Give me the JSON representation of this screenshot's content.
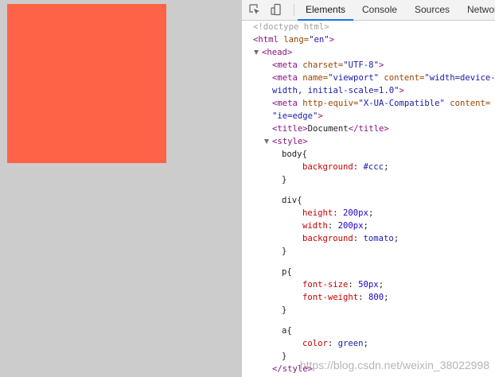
{
  "devtools": {
    "tabs": [
      {
        "label": "Elements",
        "active": true
      },
      {
        "label": "Console",
        "active": false
      },
      {
        "label": "Sources",
        "active": false
      },
      {
        "label": "Network",
        "active": false
      }
    ],
    "icons": {
      "inspect": "select-element-icon",
      "device": "device-toolbar-icon"
    }
  },
  "page_preview": {
    "box_color": "#ff6347",
    "background_color": "#cccccc"
  },
  "source": {
    "doctype": "<!doctype html>",
    "html_open": "<html",
    "html_attr": " lang=",
    "html_attr_val": "\"en\"",
    "html_close": ">",
    "head_tag": "<head>",
    "meta1_tag": "<meta",
    "meta1_attr": " charset=",
    "meta1_val": "\"UTF-8\"",
    "meta1_end": ">",
    "meta2_tag": "<meta",
    "meta2_attr1": " name=",
    "meta2_val1": "\"viewport\"",
    "meta2_attr2": " content=",
    "meta2_val2a": "\"width=device-",
    "meta2_val2b": "width, initial-scale=1.0\"",
    "meta2_end": ">",
    "meta3_tag": "<meta",
    "meta3_attr1": " http-equiv=",
    "meta3_val1": "\"X-UA-Compatible\"",
    "meta3_attr2": " content=",
    "meta3_val2": "\"ie=edge\"",
    "meta3_end": ">",
    "title_open": "<title>",
    "title_text": "Document",
    "title_close": "</title>",
    "style_open": "<style>",
    "style_close": "</style>",
    "rules": [
      {
        "selector": "body{",
        "decls": [
          {
            "prop": "background",
            "val": "#ccc",
            "val_kind": "kw"
          }
        ]
      },
      {
        "selector": "div{",
        "decls": [
          {
            "prop": "height",
            "val": "200px",
            "val_kind": "num"
          },
          {
            "prop": "width",
            "val": "200px",
            "val_kind": "num"
          },
          {
            "prop": "background",
            "val": "tomato",
            "val_kind": "kw"
          }
        ]
      },
      {
        "selector": "p{",
        "decls": [
          {
            "prop": "font-size",
            "val": "50px",
            "val_kind": "num"
          },
          {
            "prop": "font-weight",
            "val": "800",
            "val_kind": "num"
          }
        ]
      },
      {
        "selector": "a{",
        "decls": [
          {
            "prop": "color",
            "val": "green",
            "val_kind": "kw"
          }
        ]
      }
    ],
    "rule_close": "}"
  },
  "watermark": "https://blog.csdn.net/weixin_38022998"
}
